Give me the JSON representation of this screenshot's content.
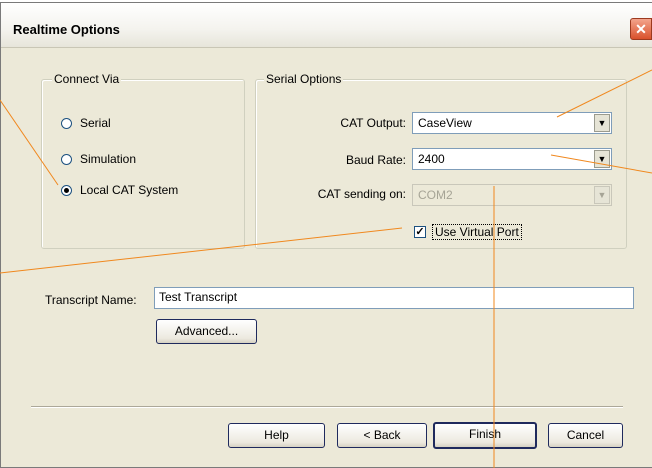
{
  "window": {
    "title": "Realtime Options",
    "close_glyph": "✕"
  },
  "connect_via": {
    "legend": "Connect Via",
    "options": [
      {
        "label": "Serial",
        "checked": false
      },
      {
        "label": "Simulation",
        "checked": false
      },
      {
        "label": "Local CAT System",
        "checked": true
      }
    ]
  },
  "serial_options": {
    "legend": "Serial Options",
    "cat_output_label": "CAT Output:",
    "cat_output_value": "CaseView",
    "baud_rate_label": "Baud Rate:",
    "baud_rate_value": "2400",
    "cat_sending_label": "CAT sending on:",
    "cat_sending_value": "COM2",
    "use_virtual_port_label": "Use Virtual Port",
    "use_virtual_port_checked": true
  },
  "transcript": {
    "label": "Transcript Name:",
    "value": "Test Transcript",
    "advanced_label": "Advanced..."
  },
  "footer": {
    "help_label": "Help",
    "back_label": "< Back",
    "finish_label": "Finish",
    "cancel_label": "Cancel"
  },
  "colors": {
    "dialog_bg": "#ece9d8",
    "callout_line": "#f0881e",
    "close_button": "#d9512c"
  },
  "icons": {
    "close": "close-icon",
    "dropdown": "chevron-down-icon",
    "check": "checkmark-icon"
  }
}
